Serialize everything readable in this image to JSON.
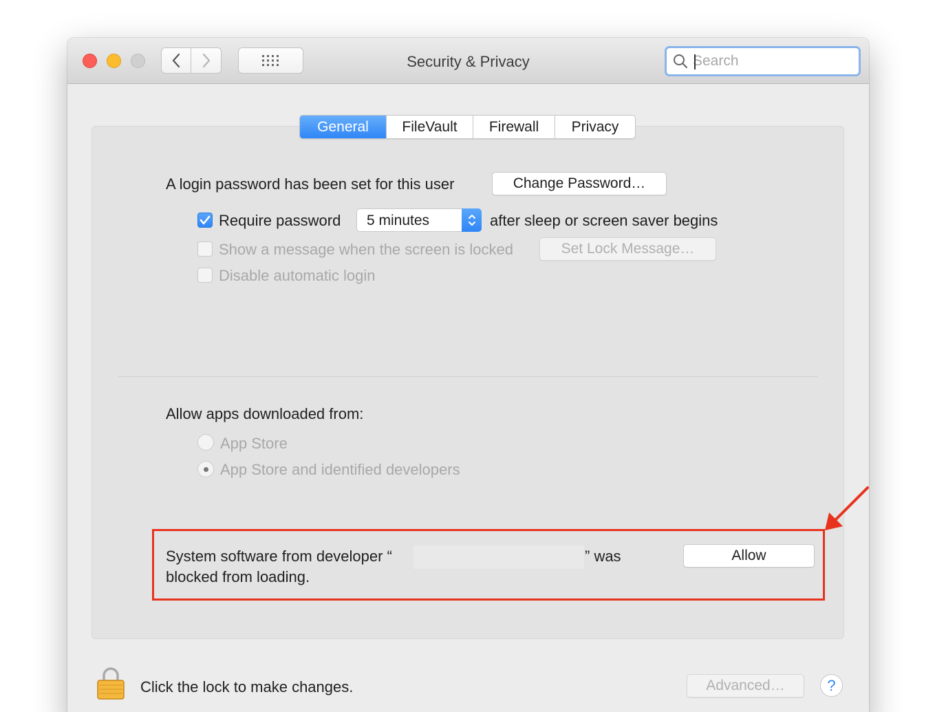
{
  "window": {
    "title": "Security & Privacy"
  },
  "search": {
    "placeholder": "Search"
  },
  "tabs": [
    {
      "label": "General",
      "active": true
    },
    {
      "label": "FileVault",
      "active": false
    },
    {
      "label": "Firewall",
      "active": false
    },
    {
      "label": "Privacy",
      "active": false
    }
  ],
  "general": {
    "login_password_text": "A login password has been set for this user",
    "change_password_label": "Change Password…",
    "require_password": {
      "label": "Require password",
      "checked": true
    },
    "require_password_delay": "5 minutes",
    "after_sleep_text": "after sleep or screen saver begins",
    "show_message": {
      "label": "Show a message when the screen is locked",
      "checked": false,
      "enabled": false
    },
    "set_lock_message_label": "Set Lock Message…",
    "disable_auto_login": {
      "label": "Disable automatic login",
      "checked": false,
      "enabled": false
    }
  },
  "downloads": {
    "heading": "Allow apps downloaded from:",
    "options": [
      {
        "label": "App Store",
        "selected": false
      },
      {
        "label": "App Store and identified developers",
        "selected": true
      }
    ]
  },
  "blocked": {
    "line1_prefix": "System software from developer “",
    "line1_suffix": "” was",
    "line2": "blocked from loading.",
    "allow_label": "Allow"
  },
  "footer": {
    "lock_text": "Click the lock to make changes.",
    "advanced_label": "Advanced…",
    "help_label": "?"
  },
  "colors": {
    "accent": "#2f86f6",
    "highlight": "#e8321e",
    "close": "#fc5f57",
    "minimize": "#fdbc2e"
  }
}
